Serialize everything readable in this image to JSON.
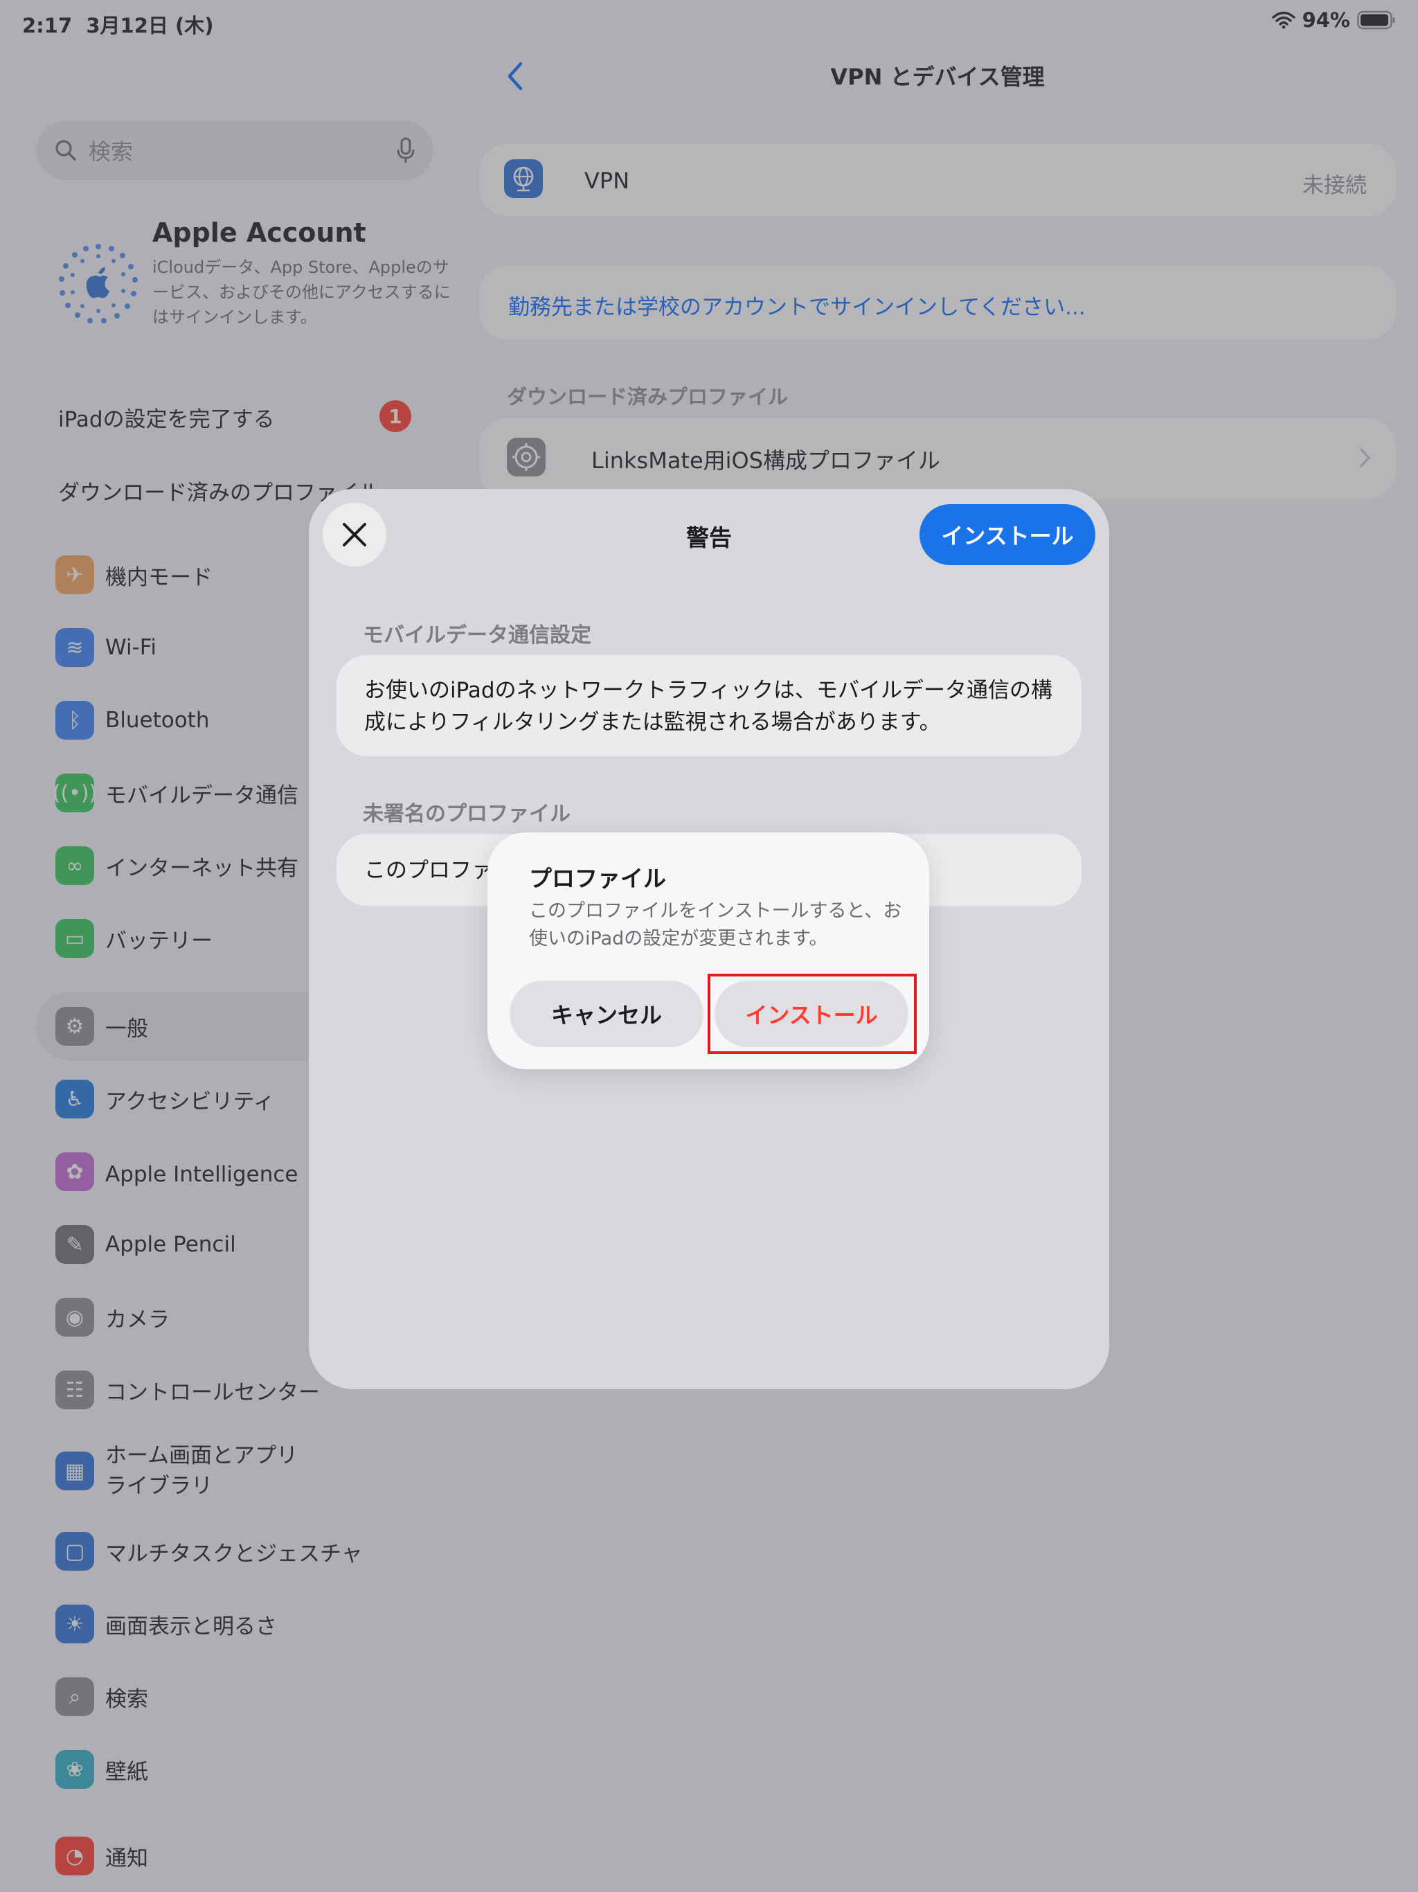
{
  "status_bar": {
    "time": "2:17",
    "date": "3月12日 (木)",
    "battery": "94%"
  },
  "sidebar": {
    "search_placeholder": "検索",
    "account": {
      "name": "Apple Account",
      "description": "iCloudデータ、App Store、Appleのサービス、およびその他にアクセスするにはサインインします。"
    },
    "setup_row": "iPadの設定を完了する",
    "setup_badge": "1",
    "downloaded_profile_row": "ダウンロード済みのプロファイル",
    "items": [
      {
        "label": "機内モード",
        "icon": "airplane-icon",
        "color": "#f0a35a"
      },
      {
        "label": "Wi-Fi",
        "icon": "wifi-icon",
        "color": "#3b82f6"
      },
      {
        "label": "Bluetooth",
        "icon": "bluetooth-icon",
        "color": "#3b82f6"
      },
      {
        "label": "モバイルデータ通信",
        "icon": "antenna-icon",
        "color": "#34c759"
      },
      {
        "label": "インターネット共有",
        "icon": "link-icon",
        "color": "#34c759"
      },
      {
        "label": "バッテリー",
        "icon": "battery-icon",
        "color": "#34c759"
      },
      {
        "label": "一般",
        "icon": "gear-icon",
        "color": "#8e8e93"
      },
      {
        "label": "アクセシビリティ",
        "icon": "accessibility-icon",
        "color": "#1f7ae0"
      },
      {
        "label": "Apple Intelligence と",
        "icon": "apple-intelligence-icon",
        "color": "#c66bd6"
      },
      {
        "label": "Apple Pencil",
        "icon": "pencil-icon",
        "color": "#6e6e73"
      },
      {
        "label": "カメラ",
        "icon": "camera-icon",
        "color": "#8e8e93"
      },
      {
        "label": "コントロールセンター",
        "icon": "toggles-icon",
        "color": "#8e8e93"
      },
      {
        "label": "ホーム画面とアプリ\nライブラリ",
        "icon": "home-screen-icon",
        "color": "#2f73d6"
      },
      {
        "label": "マルチタスクとジェスチャ",
        "icon": "multitask-icon",
        "color": "#2f73d6"
      },
      {
        "label": "画面表示と明るさ",
        "icon": "sun-icon",
        "color": "#2f73d6"
      },
      {
        "label": "検索",
        "icon": "search-icon",
        "color": "#8e8e93"
      },
      {
        "label": "壁紙",
        "icon": "flower-icon",
        "color": "#30b0c7"
      },
      {
        "label": "通知",
        "icon": "bell-icon",
        "color": "#ff3b30"
      }
    ]
  },
  "detail": {
    "title": "VPN とデバイス管理",
    "vpn_label": "VPN",
    "vpn_status": "未接続",
    "signin_link": "勤務先または学校のアカウントでサインインしてください...",
    "downloaded_header": "ダウンロード済みプロファイル",
    "profile_name": "LinksMate用iOS構成プロファイル"
  },
  "sheet": {
    "title": "警告",
    "install_label": "インストール",
    "mobile_section": "モバイルデータ通信設定",
    "mobile_text": "お使いのiPadのネットワークトラフィックは、モバイルデータ通信の構成によりフィルタリングまたは監視される場合があります。",
    "unsigned_section": "未署名のプロファイル",
    "unsigned_text": "このプロファ"
  },
  "alert": {
    "title": "プロファイル",
    "message": "このプロファイルをインストールすると、お使いのiPadの設定が変更されます。",
    "cancel_label": "キャンセル",
    "install_label": "インストール"
  }
}
